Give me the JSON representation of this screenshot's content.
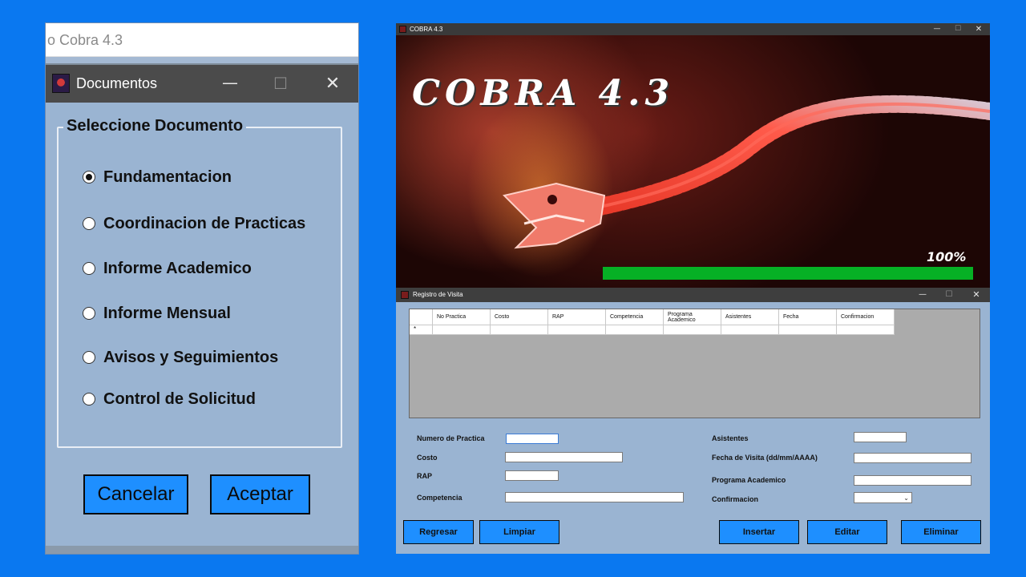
{
  "documentos_window": {
    "behind_title": "o Cobra 4.3",
    "title": "Documentos",
    "controls": {
      "minimize": "—",
      "maximize": "☐",
      "close": "✕"
    },
    "group_label": "Seleccione Documento",
    "options": [
      {
        "label": "Fundamentacion",
        "selected": true
      },
      {
        "label": "Coordinacion de Practicas",
        "selected": false
      },
      {
        "label": "Informe Academico",
        "selected": false
      },
      {
        "label": "Informe Mensual",
        "selected": false
      },
      {
        "label": "Avisos y Seguimientos",
        "selected": false
      },
      {
        "label": "Control de Solicitud",
        "selected": false
      }
    ],
    "cancel_label": "Cancelar",
    "accept_label": "Aceptar",
    "button_color": "#1e8fff"
  },
  "cobra_window": {
    "title": "COBRA 4.3",
    "controls": {
      "minimize": "—",
      "maximize": "☐",
      "close": "✕"
    },
    "logo_text": "COBRA 4.3",
    "progress_label": "100%",
    "progress_value": 100,
    "progress_color": "#06b025"
  },
  "registro_window": {
    "title": "Registro de Visita",
    "controls": {
      "minimize": "—",
      "maximize": "☐",
      "close": "✕"
    },
    "grid": {
      "new_row_marker": "*",
      "columns": [
        "No Practica",
        "Costo",
        "RAP",
        "Competencia",
        "Programa Academico",
        "Asistentes",
        "Fecha",
        "Confirmacion"
      ]
    },
    "fields": {
      "numero_practica": {
        "label": "Numero de Practica",
        "value": ""
      },
      "costo": {
        "label": "Costo",
        "value": ""
      },
      "rap": {
        "label": "RAP",
        "value": ""
      },
      "competencia": {
        "label": "Competencia",
        "value": ""
      },
      "asistentes": {
        "label": "Asistentes",
        "value": ""
      },
      "fecha_visita": {
        "label": "Fecha de Visita (dd/mm/AAAA)",
        "value": ""
      },
      "programa_academico": {
        "label": "Programa Academico",
        "value": ""
      },
      "confirmacion": {
        "label": "Confirmacion",
        "value": ""
      }
    },
    "buttons": {
      "regresar": "Regresar",
      "limpiar": "Limpiar",
      "insertar": "Insertar",
      "editar": "Editar",
      "eliminar": "Eliminar"
    },
    "background_color": "#9ab4d2"
  }
}
